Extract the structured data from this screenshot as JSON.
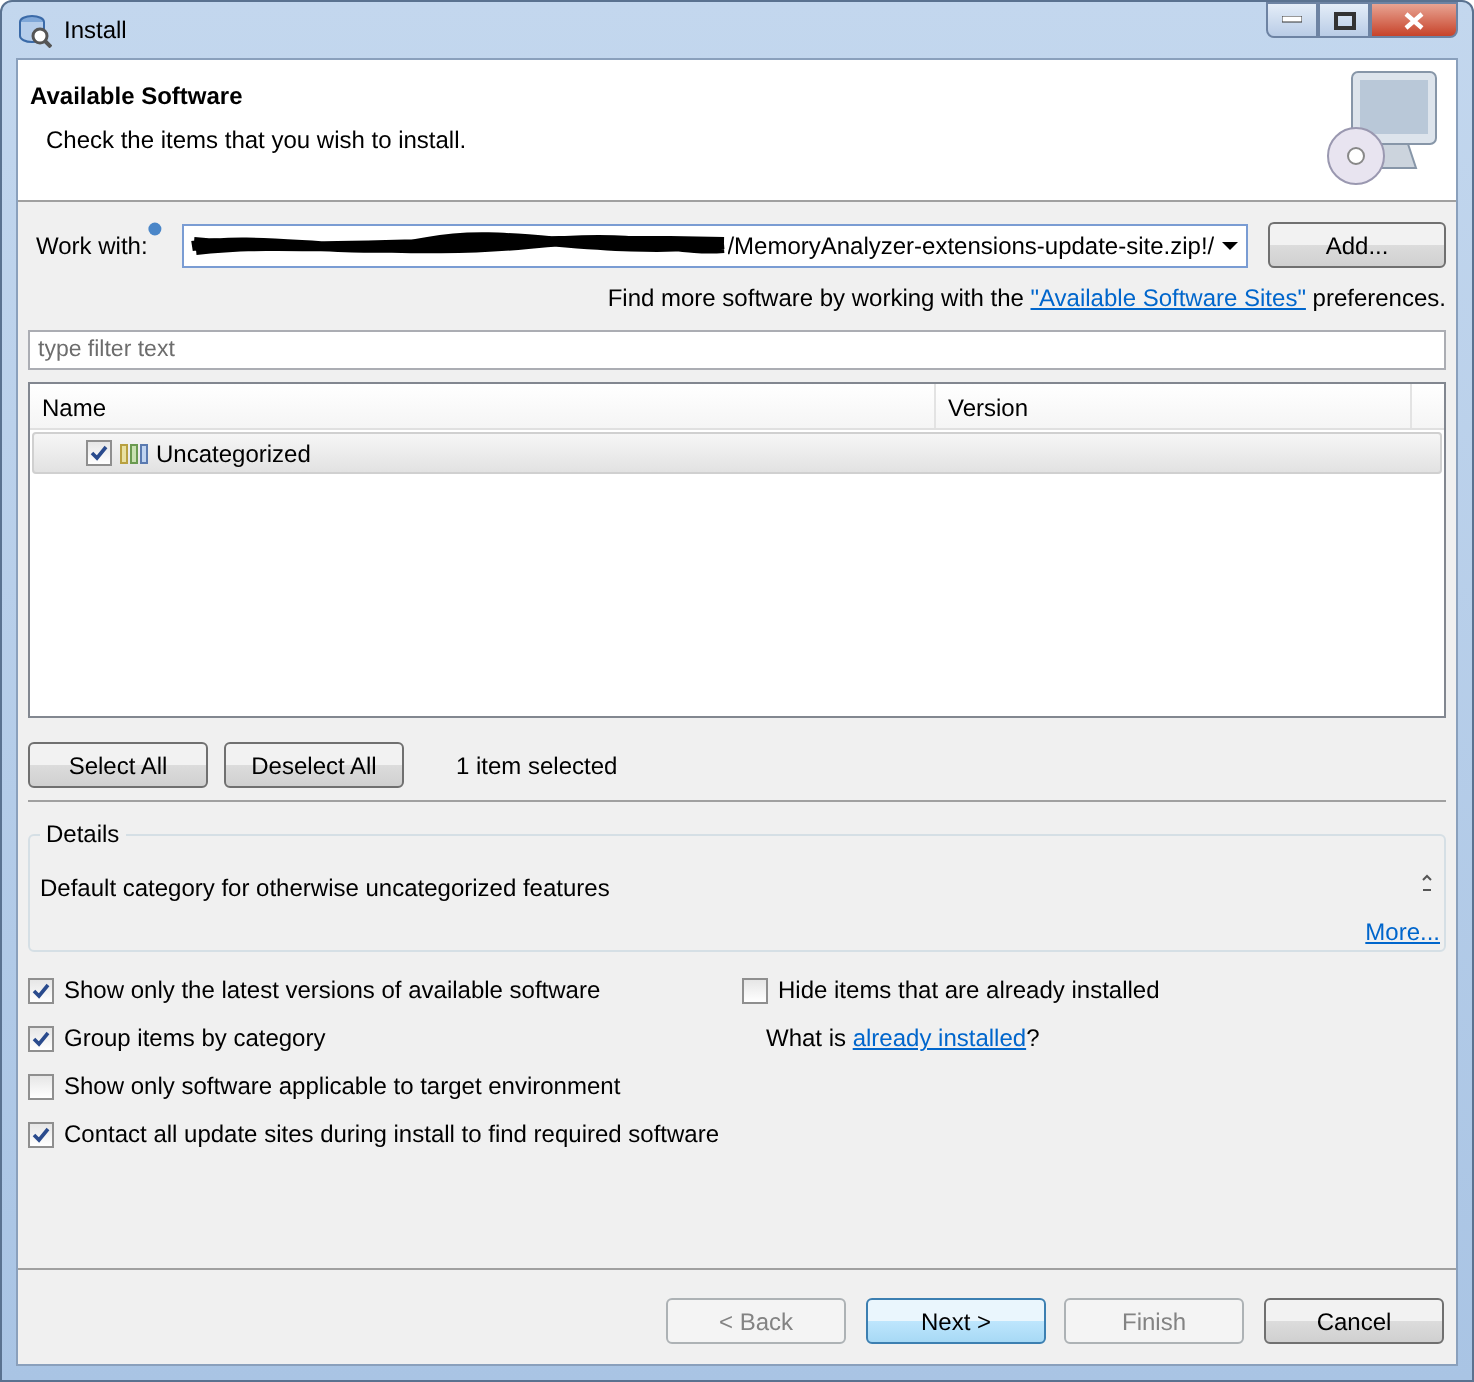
{
  "window": {
    "title": "Install"
  },
  "header": {
    "title": "Available Software",
    "subtitle": "Check the items that you wish to install."
  },
  "work_with": {
    "label": "Work with:",
    "value": "/MemoryAnalyzer-extensions-update-site.zip!/",
    "redacted": true,
    "add_button": "Add..."
  },
  "find_more": {
    "before": "Find more software by working with the ",
    "link": "\"Available Software Sites\"",
    "after": " preferences."
  },
  "filter": {
    "placeholder": "type filter text"
  },
  "tree": {
    "columns": [
      "Name",
      "Version"
    ],
    "rows": [
      {
        "label": "Uncategorized",
        "checked": true,
        "selected": true
      }
    ]
  },
  "selection_buttons": [
    "Select All",
    "Deselect All"
  ],
  "selection_status": "1 item selected",
  "details": {
    "title": "Details",
    "text": "Default category for otherwise uncategorized features",
    "more_link": "More..."
  },
  "options_left": [
    {
      "kind": "checkbox",
      "label": "Show only the latest versions of available software",
      "checked": true
    },
    {
      "kind": "checkbox",
      "label": "Group items by category",
      "checked": true
    },
    {
      "kind": "checkbox",
      "label": "Show only software applicable to target environment",
      "checked": false
    },
    {
      "kind": "checkbox",
      "label": "Contact all update sites during install to find required software",
      "checked": true
    }
  ],
  "options_right": [
    {
      "kind": "checkbox",
      "label": "Hide items that are already installed",
      "checked": false
    },
    {
      "kind": "link_text",
      "before": "What is ",
      "link": "already installed",
      "after": "?"
    }
  ],
  "buttons": [
    {
      "label": "< Back",
      "disabled": true,
      "default": false
    },
    {
      "label": "Next >",
      "disabled": false,
      "default": true
    },
    {
      "label": "Finish",
      "disabled": true,
      "default": false
    },
    {
      "label": "Cancel",
      "disabled": false,
      "default": false
    }
  ]
}
